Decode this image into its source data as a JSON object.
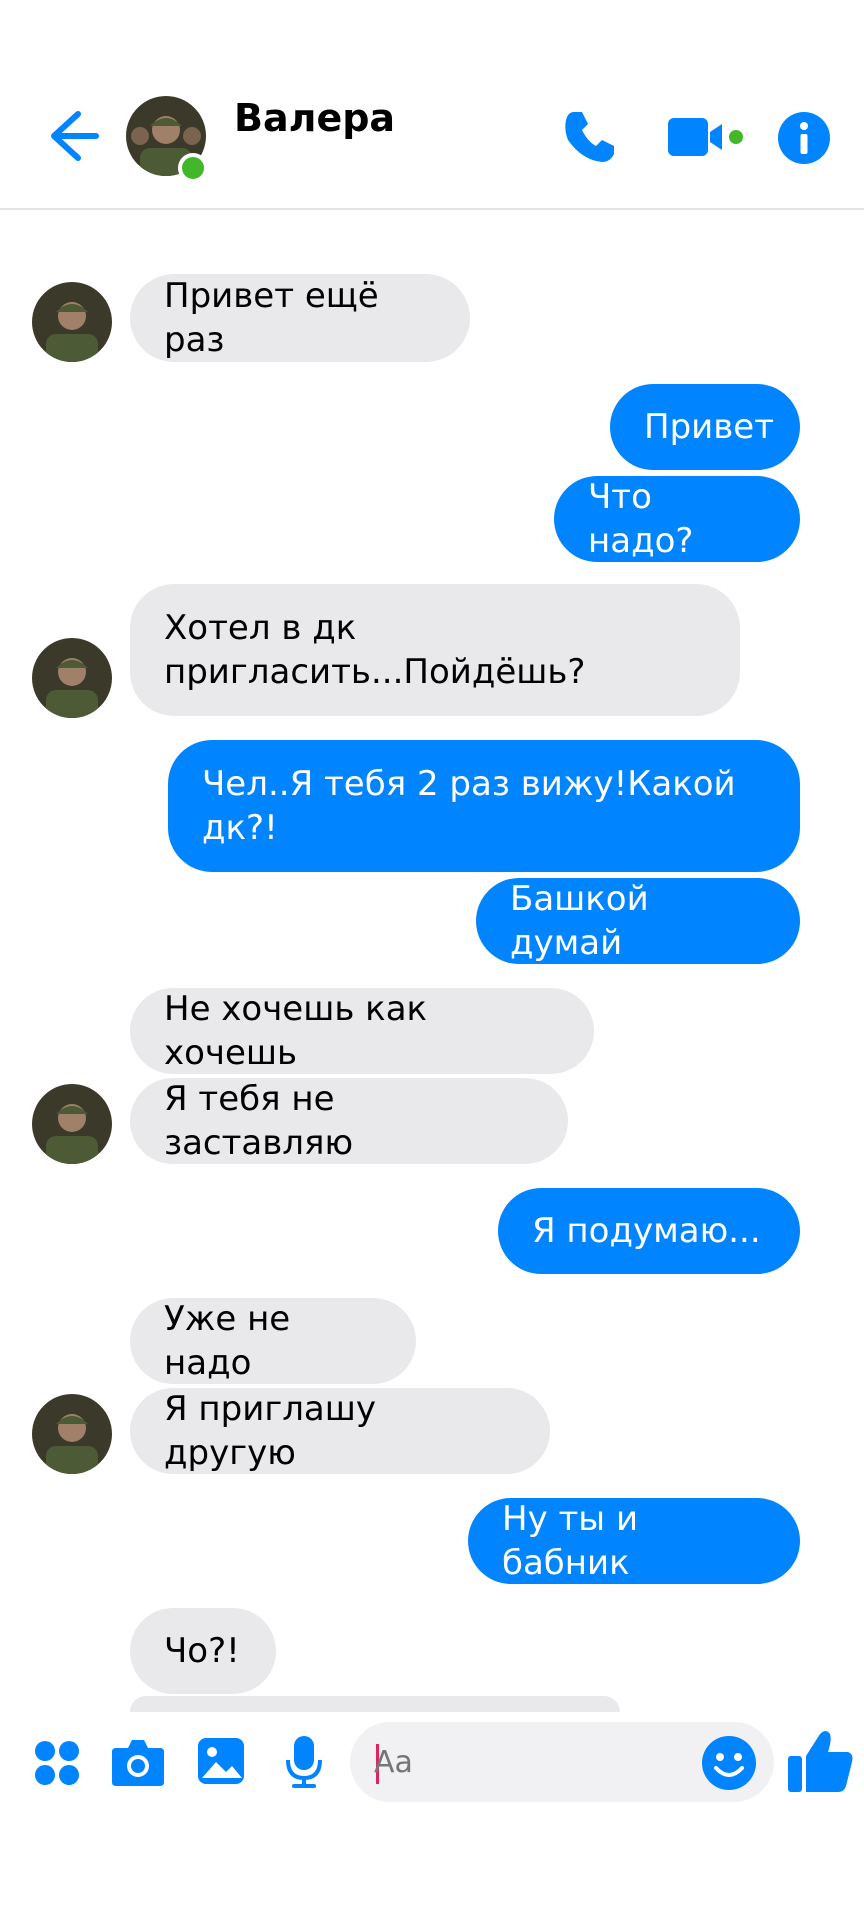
{
  "header": {
    "contact_name": "Валера",
    "back_icon": "back-arrow-icon",
    "call_icon": "phone-icon",
    "video_icon": "video-camera-icon",
    "info_icon": "info-icon"
  },
  "colors": {
    "accent": "#0084ff",
    "incoming_bubble": "#e9e9eb",
    "online": "#42b72a"
  },
  "messages": [
    {
      "dir": "in",
      "text": "Привет ещё раз"
    },
    {
      "dir": "out",
      "text": "Привет"
    },
    {
      "dir": "out",
      "text": "Что надо?"
    },
    {
      "dir": "in",
      "text": "Хотел в дк пригласить...Пойдёшь?"
    },
    {
      "dir": "out",
      "text": "Чел..Я тебя 2 раз вижу!Какой дк?!"
    },
    {
      "dir": "out",
      "text": "Башкой думай"
    },
    {
      "dir": "in",
      "text": "Не хочешь как хочешь"
    },
    {
      "dir": "in",
      "text": "Я тебя не заставляю"
    },
    {
      "dir": "out",
      "text": "Я подумаю..."
    },
    {
      "dir": "in",
      "text": "Уже не надо"
    },
    {
      "dir": "in",
      "text": "Я приглашу другую"
    },
    {
      "dir": "out",
      "text": "Ну ты и бабник"
    },
    {
      "dir": "in",
      "text": "Чо?!"
    }
  ],
  "composer": {
    "placeholder": "Aa",
    "menu_icon": "four-dots-menu-icon",
    "camera_icon": "camera-icon",
    "gallery_icon": "image-icon",
    "mic_icon": "microphone-icon",
    "emoji_icon": "smiley-icon",
    "like_icon": "thumbs-up-icon"
  }
}
